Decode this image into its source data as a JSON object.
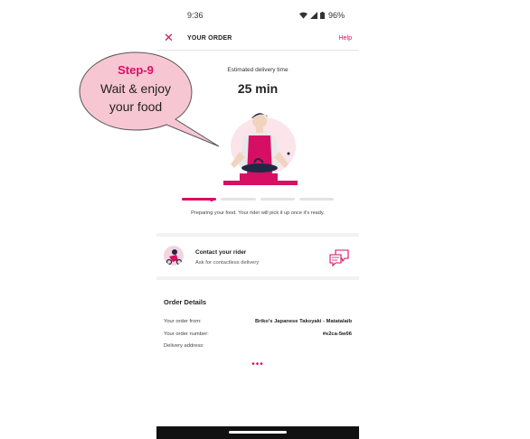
{
  "status_bar": {
    "time": "9:36",
    "battery": "96%"
  },
  "header": {
    "title": "YOUR ORDER",
    "help": "Help"
  },
  "delivery": {
    "label": "Estimated delivery time",
    "time": "25 min",
    "progress_step": 1,
    "progress_total": 4
  },
  "status_message": "Preparing your food. Your rider will pick it up once it's ready.",
  "contact": {
    "title": "Contact your rider",
    "subtitle": "Ask for contactless delivery"
  },
  "order_details": {
    "title": "Order Details",
    "rows": [
      {
        "label": "Your order from:",
        "value": "Briko's Japanese Takoyaki - Matatalaib"
      },
      {
        "label": "Your order number:",
        "value": "#e2ca-5w06"
      },
      {
        "label": "Delivery address:",
        "value": ""
      }
    ]
  },
  "callout": {
    "step": "Step-9",
    "line1": "Wait & enjoy",
    "line2": "your food"
  },
  "colors": {
    "accent": "#d70f64",
    "callout_fill": "#f7c6d3",
    "callout_stroke": "#555555"
  },
  "icons": [
    "close-icon",
    "wifi-icon",
    "signal-icon",
    "battery-icon",
    "chef-illustration",
    "rider-avatar",
    "chat-icon",
    "more-dots-icon"
  ]
}
